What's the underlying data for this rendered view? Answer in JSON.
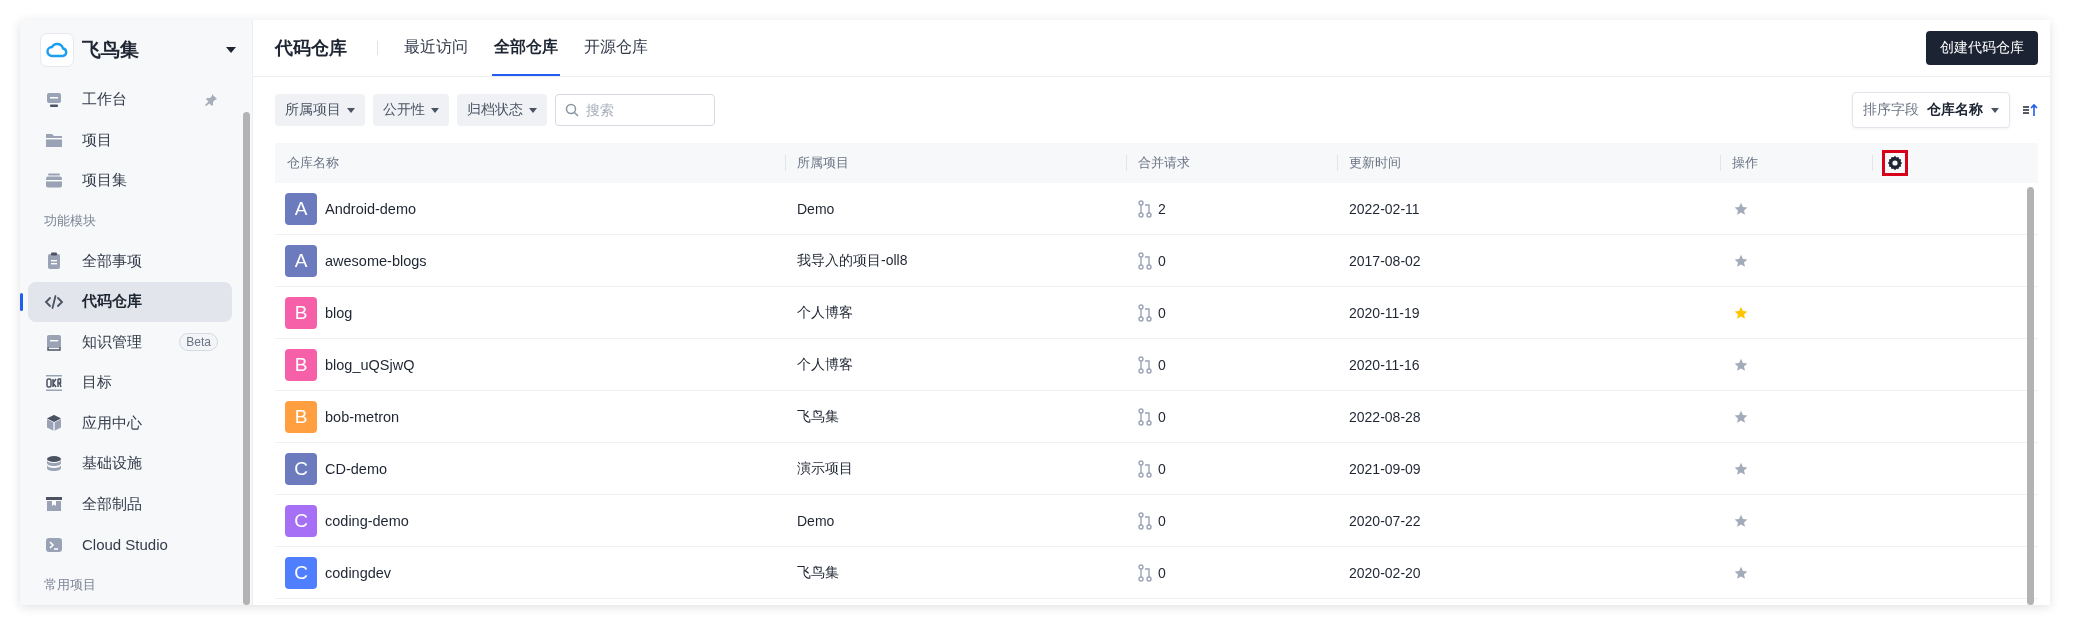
{
  "brand": {
    "name": "飞鸟集"
  },
  "sidebar": {
    "items": [
      {
        "kind": "item",
        "label": "工作台",
        "selected": false,
        "pinned": true
      },
      {
        "kind": "item",
        "label": "项目",
        "selected": false,
        "pinned": false
      },
      {
        "kind": "item",
        "label": "项目集",
        "selected": false,
        "pinned": false
      },
      {
        "kind": "section",
        "label": "功能模块"
      },
      {
        "kind": "item",
        "label": "全部事项",
        "selected": false,
        "pinned": false
      },
      {
        "kind": "item",
        "label": "代码仓库",
        "selected": true,
        "pinned": false
      },
      {
        "kind": "item",
        "label": "知识管理",
        "selected": false,
        "pinned": false,
        "badge": "Beta"
      },
      {
        "kind": "item",
        "label": "目标",
        "selected": false,
        "pinned": false
      },
      {
        "kind": "item",
        "label": "应用中心",
        "selected": false,
        "pinned": false
      },
      {
        "kind": "item",
        "label": "基础设施",
        "selected": false,
        "pinned": false
      },
      {
        "kind": "item",
        "label": "全部制品",
        "selected": false,
        "pinned": false
      },
      {
        "kind": "item",
        "label": "Cloud Studio",
        "selected": false,
        "pinned": false
      },
      {
        "kind": "section",
        "label": "常用项目"
      }
    ]
  },
  "header": {
    "title": "代码仓库",
    "tabs": [
      {
        "label": "最近访问",
        "selected": false
      },
      {
        "label": "全部仓库",
        "selected": true
      },
      {
        "label": "开源仓库",
        "selected": false
      }
    ],
    "create_button": "创建代码仓库"
  },
  "filters": [
    "所属项目",
    "公开性",
    "归档状态"
  ],
  "search": {
    "placeholder": "搜索"
  },
  "sort": {
    "label": "排序字段",
    "value": "仓库名称"
  },
  "table": {
    "columns": [
      "仓库名称",
      "所属项目",
      "合并请求",
      "更新时间",
      "操作"
    ],
    "settings_highlighted": true,
    "rows": [
      {
        "letter": "A",
        "color": "#6b7bbd",
        "name": "Android-demo",
        "project": "Demo",
        "merge_requests": "2",
        "updated": "2022-02-11",
        "starred": false
      },
      {
        "letter": "A",
        "color": "#6b7bbd",
        "name": "awesome-blogs",
        "project": "我导入的项目-oll8",
        "merge_requests": "0",
        "updated": "2017-08-02",
        "starred": false
      },
      {
        "letter": "B",
        "color": "#f660a9",
        "name": "blog",
        "project": "个人博客",
        "merge_requests": "0",
        "updated": "2020-11-19",
        "starred": true
      },
      {
        "letter": "B",
        "color": "#f660a9",
        "name": "blog_uQSjwQ",
        "project": "个人博客",
        "merge_requests": "0",
        "updated": "2020-11-16",
        "starred": false
      },
      {
        "letter": "B",
        "color": "#ff9f40",
        "name": "bob-metron",
        "project": "飞鸟集",
        "merge_requests": "0",
        "updated": "2022-08-28",
        "starred": false
      },
      {
        "letter": "C",
        "color": "#6b7bbd",
        "name": "CD-demo",
        "project": "演示项目",
        "merge_requests": "0",
        "updated": "2021-09-09",
        "starred": false
      },
      {
        "letter": "C",
        "color": "#a570f5",
        "name": "coding-demo",
        "project": "Demo",
        "merge_requests": "0",
        "updated": "2020-07-22",
        "starred": false
      },
      {
        "letter": "C",
        "color": "#4f7fff",
        "name": "codingdev",
        "project": "飞鸟集",
        "merge_requests": "0",
        "updated": "2020-02-20",
        "starred": false
      }
    ]
  }
}
